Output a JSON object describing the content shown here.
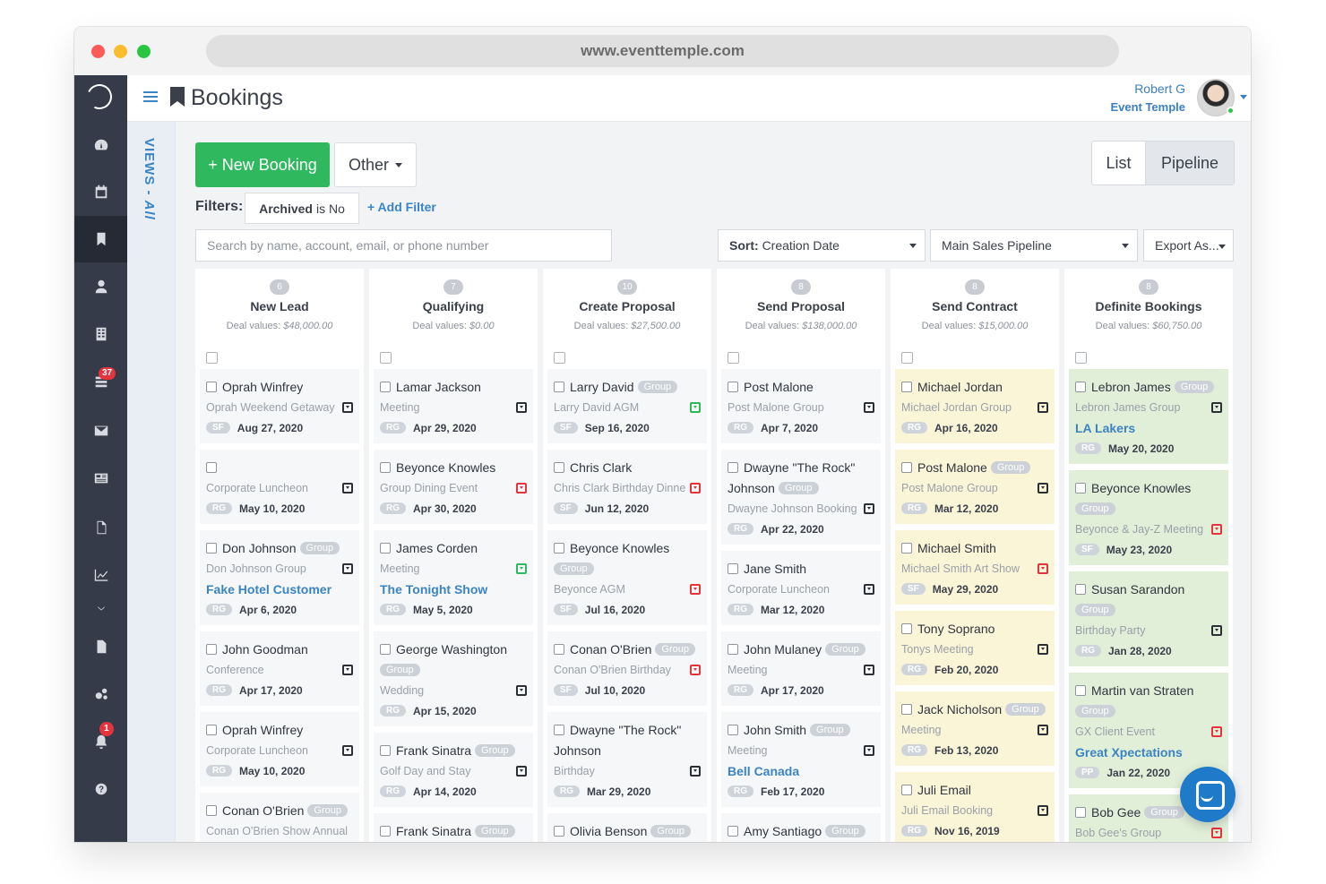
{
  "browser": {
    "url": "www.eventtemple.com"
  },
  "sidebar": {
    "badges": {
      "tasks": "37",
      "notifications": "1"
    }
  },
  "header": {
    "title": "Bookings",
    "user_name": "Robert G",
    "user_org": "Event Temple"
  },
  "views_label": {
    "prefix": "VIEWS - ",
    "value": "All"
  },
  "toolbar": {
    "new_booking": "+ New Booking",
    "other": "Other",
    "view_list": "List",
    "view_pipeline": "Pipeline",
    "filters_label": "Filters:",
    "filter_field": "Archived",
    "filter_rest": "is No",
    "add_filter": "+ Add Filter",
    "search_placeholder": "Search by name, account, email, or phone number",
    "sort_label": "Sort:",
    "sort_value": "Creation Date",
    "pipeline_select": "Main Sales Pipeline",
    "export": "Export As..."
  },
  "columns": [
    {
      "count": "6",
      "title": "New Lead",
      "deal_label": "Deal values:",
      "deal_value": "$48,000.00",
      "cards": [
        {
          "name": "Oprah Winfrey",
          "sub": "Oprah Weekend Getaway",
          "icon": "black",
          "initials": "SF",
          "date": "Aug 27, 2020"
        },
        {
          "name": "",
          "sub": "Corporate Luncheon",
          "icon": "black",
          "initials": "RG",
          "date": "May 10, 2020"
        },
        {
          "name": "Don Johnson",
          "group": "Group",
          "sub": "Don Johnson Group",
          "icon": "black",
          "link": "Fake Hotel Customer",
          "initials": "RG",
          "date": "Apr 6, 2020"
        },
        {
          "name": "John Goodman",
          "sub": "Conference",
          "icon": "black",
          "initials": "RG",
          "date": "Apr 17, 2020"
        },
        {
          "name": "Oprah Winfrey",
          "sub": "Corporate Luncheon",
          "icon": "black",
          "initials": "RG",
          "date": "May 10, 2020"
        },
        {
          "name": "Conan O'Brien",
          "group": "Group",
          "sub": "Conan O'Brien Show Annual"
        }
      ]
    },
    {
      "count": "7",
      "title": "Qualifying",
      "deal_label": "Deal values:",
      "deal_value": "$0.00",
      "cards": [
        {
          "name": "Lamar Jackson",
          "sub": "Meeting",
          "icon": "black",
          "initials": "RG",
          "date": "Apr 29, 2020"
        },
        {
          "name": "Beyonce Knowles",
          "sub": "Group Dining Event",
          "icon": "red",
          "initials": "RG",
          "date": "Apr 30, 2020"
        },
        {
          "name": "James Corden",
          "sub": "Meeting",
          "icon": "green",
          "link": "The Tonight Show",
          "initials": "RG",
          "date": "May 5, 2020"
        },
        {
          "name": "George Washington",
          "group_line": "Group",
          "sub": "Wedding",
          "icon": "black",
          "initials": "RG",
          "date": "Apr 15, 2020"
        },
        {
          "name": "Frank Sinatra",
          "group": "Group",
          "sub": "Golf Day and Stay",
          "icon": "black",
          "initials": "RG",
          "date": "Apr 14, 2020"
        },
        {
          "name": "Frank Sinatra",
          "group": "Group"
        }
      ]
    },
    {
      "count": "10",
      "title": "Create Proposal",
      "deal_label": "Deal values:",
      "deal_value": "$27,500.00",
      "cards": [
        {
          "name": "Larry David",
          "group": "Group",
          "sub": "Larry David AGM",
          "icon": "green",
          "initials": "SF",
          "date": "Sep 16, 2020"
        },
        {
          "name": "Chris Clark",
          "sub": "Chris Clark Birthday Dinner",
          "icon": "red",
          "initials": "SF",
          "date": "Jun 12, 2020"
        },
        {
          "name": "Beyonce Knowles",
          "group_line": "Group",
          "sub": "Beyonce AGM",
          "icon": "red",
          "initials": "SF",
          "date": "Jul 16, 2020"
        },
        {
          "name": "Conan O'Brien",
          "group": "Group",
          "sub": "Conan O'Brien Birthday",
          "icon": "red",
          "initials": "SF",
          "date": "Jul 10, 2020"
        },
        {
          "name": "Dwayne \"The Rock\"",
          "name2": "Johnson",
          "sub": "Birthday",
          "icon": "black",
          "initials": "RG",
          "date": "Mar 29, 2020"
        },
        {
          "name": "Olivia Benson",
          "group": "Group"
        }
      ]
    },
    {
      "count": "8",
      "title": "Send Proposal",
      "deal_label": "Deal values:",
      "deal_value": "$138,000.00",
      "cards": [
        {
          "name": "Post Malone",
          "sub": "Post Malone Group",
          "icon": "black",
          "initials": "RG",
          "date": "Apr 7, 2020"
        },
        {
          "name": "Dwayne \"The Rock\"",
          "name2": "Johnson",
          "group2": "Group",
          "sub": "Dwayne Johnson Booking",
          "icon": "black",
          "initials": "RG",
          "date": "Apr 22, 2020"
        },
        {
          "name": "Jane Smith",
          "sub": "Corporate Luncheon",
          "icon": "black",
          "initials": "RG",
          "date": "Mar 12, 2020"
        },
        {
          "name": "John Mulaney",
          "group": "Group",
          "sub": "Meeting",
          "icon": "black",
          "initials": "RG",
          "date": "Apr 17, 2020"
        },
        {
          "name": "John Smith",
          "group": "Group",
          "sub": "Meeting",
          "icon": "black",
          "link": "Bell Canada",
          "initials": "RG",
          "date": "Feb 17, 2020"
        },
        {
          "name": "Amy Santiago",
          "group": "Group"
        }
      ]
    },
    {
      "count": "8",
      "title": "Send Contract",
      "deal_label": "Deal values:",
      "deal_value": "$15,000.00",
      "tone": "yellow",
      "cards": [
        {
          "name": "Michael Jordan",
          "sub": "Michael Jordan Group",
          "icon": "black",
          "initials": "RG",
          "date": "Apr 16, 2020"
        },
        {
          "name": "Post Malone",
          "group": "Group",
          "sub": "Post Malone Group",
          "icon": "black",
          "initials": "RG",
          "date": "Mar 12, 2020"
        },
        {
          "name": "Michael Smith",
          "sub": "Michael Smith Art Show",
          "icon": "red",
          "initials": "SF",
          "date": "May 29, 2020"
        },
        {
          "name": "Tony Soprano",
          "sub": "Tonys Meeting",
          "icon": "black",
          "initials": "RG",
          "date": "Feb 20, 2020"
        },
        {
          "name": "Jack Nicholson",
          "group": "Group",
          "sub": "Meeting",
          "icon": "black",
          "initials": "RG",
          "date": "Feb 13, 2020"
        },
        {
          "name": "Juli Email",
          "sub": "Juli Email Booking",
          "icon": "black",
          "initials": "RG",
          "date": "Nov 16, 2019"
        }
      ]
    },
    {
      "count": "8",
      "title": "Definite Bookings",
      "deal_label": "Deal values:",
      "deal_value": "$60,750.00",
      "tone": "green",
      "cards": [
        {
          "name": "Lebron James",
          "group": "Group",
          "sub": "Lebron James Group",
          "icon": "black",
          "link": "LA Lakers",
          "initials": "RG",
          "date": "May 20, 2020"
        },
        {
          "name": "Beyonce Knowles",
          "group_line": "Group",
          "sub": "Beyonce & Jay-Z Meeting",
          "icon": "red",
          "initials": "SF",
          "date": "May 23, 2020"
        },
        {
          "name": "Susan Sarandon",
          "group_line": "Group",
          "sub": "Birthday Party",
          "icon": "black",
          "initials": "RG",
          "date": "Jan 28, 2020"
        },
        {
          "name": "Martin van Straten",
          "group_line": "Group",
          "sub": "GX Client Event",
          "icon": "red",
          "link": "Great Xpectations",
          "initials": "PP",
          "date": "Jan 22, 2020"
        },
        {
          "name": "Bob Gee",
          "group": "Group",
          "sub": "Bob Gee's Group",
          "icon": "red"
        }
      ]
    }
  ]
}
